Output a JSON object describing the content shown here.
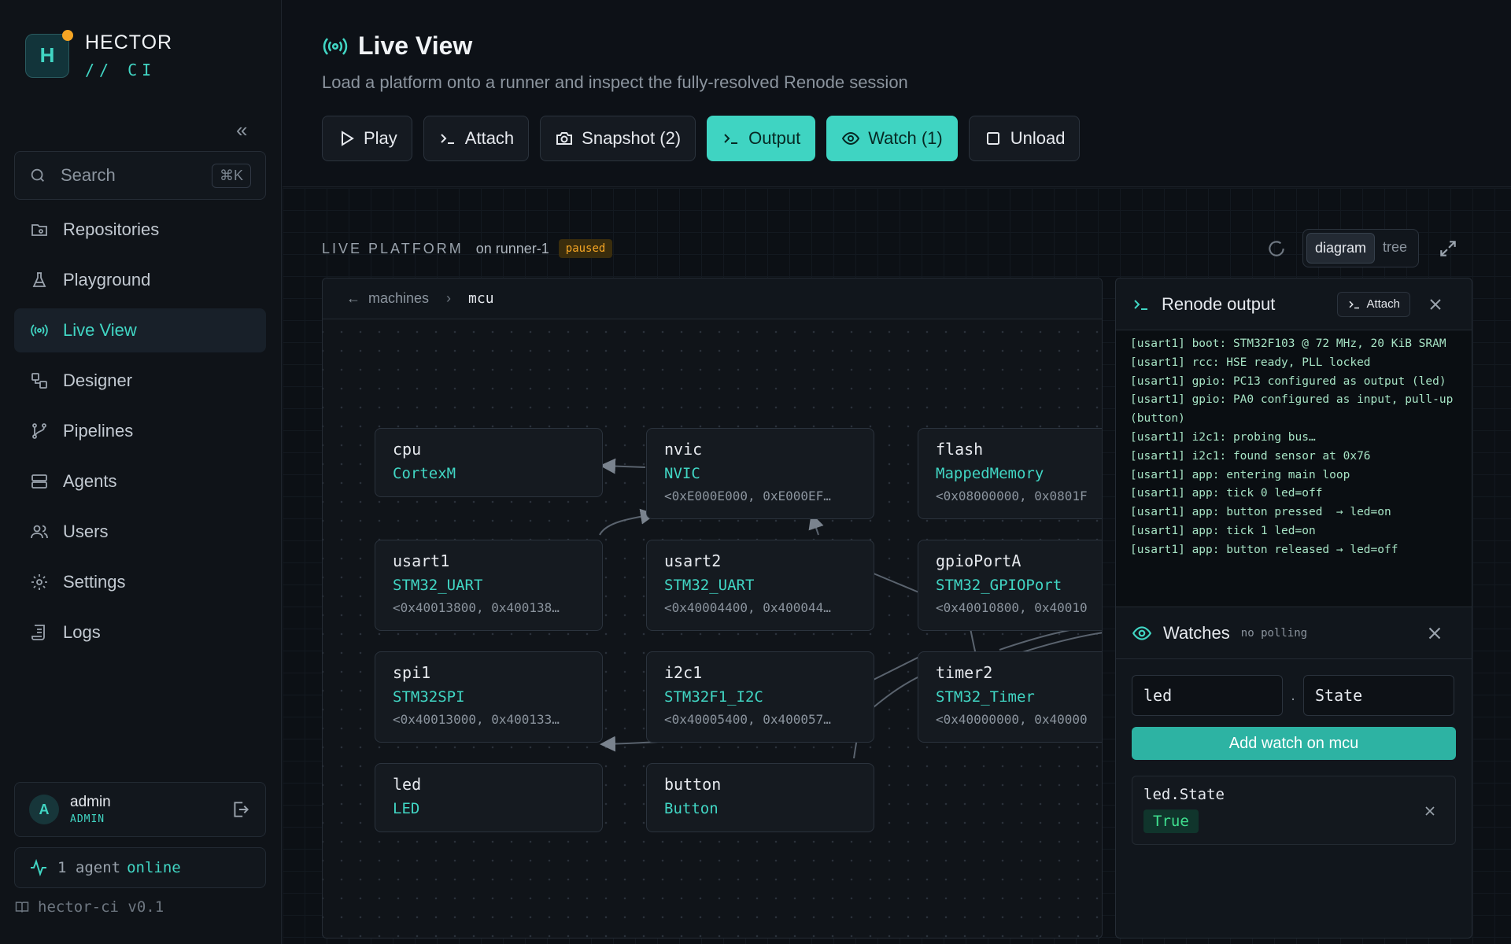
{
  "brand": {
    "logo_letter": "H",
    "name": "HECTOR",
    "sub": "// CI"
  },
  "search": {
    "placeholder": "Search",
    "shortcut": "⌘K"
  },
  "nav": [
    {
      "label": "Repositories",
      "icon": "repository-icon"
    },
    {
      "label": "Playground",
      "icon": "flask-icon"
    },
    {
      "label": "Live View",
      "icon": "broadcast-icon",
      "active": true
    },
    {
      "label": "Designer",
      "icon": "designer-icon"
    },
    {
      "label": "Pipelines",
      "icon": "pipeline-icon"
    },
    {
      "label": "Agents",
      "icon": "server-icon"
    },
    {
      "label": "Users",
      "icon": "users-icon"
    },
    {
      "label": "Settings",
      "icon": "gear-icon"
    },
    {
      "label": "Logs",
      "icon": "logs-icon"
    }
  ],
  "user": {
    "initial": "A",
    "name": "admin",
    "role": "ADMIN"
  },
  "agents": {
    "count_text": "1 agent",
    "status": "online"
  },
  "version": "hector-ci v0.1",
  "header": {
    "title": "Live View",
    "subtitle": "Load a platform onto a runner and inspect the fully-resolved Renode session"
  },
  "toolbar": {
    "play": "Play",
    "attach": "Attach",
    "snapshot": "Snapshot (2)",
    "output": "Output",
    "watch": "Watch (1)",
    "unload": "Unload"
  },
  "live": {
    "title": "LIVE PLATFORM",
    "runner": "on runner-1",
    "status": "paused",
    "view_modes": [
      "diagram",
      "tree"
    ],
    "active_view": "diagram"
  },
  "breadcrumb": {
    "parent": "machines",
    "current": "mcu"
  },
  "nodes": [
    {
      "name": "cpu",
      "type": "CortexM",
      "range": ""
    },
    {
      "name": "nvic",
      "type": "NVIC",
      "range": "<0xE000E000, 0xE000EF…"
    },
    {
      "name": "flash",
      "type": "MappedMemory",
      "range": "<0x08000000, 0x0801F"
    },
    {
      "name": "usart1",
      "type": "STM32_UART",
      "range": "<0x40013800, 0x400138…"
    },
    {
      "name": "usart2",
      "type": "STM32_UART",
      "range": "<0x40004400, 0x400044…"
    },
    {
      "name": "gpioPortA",
      "type": "STM32_GPIOPort",
      "range": "<0x40010800, 0x40010"
    },
    {
      "name": "spi1",
      "type": "STM32SPI",
      "range": "<0x40013000, 0x400133…"
    },
    {
      "name": "i2c1",
      "type": "STM32F1_I2C",
      "range": "<0x40005400, 0x400057…"
    },
    {
      "name": "timer2",
      "type": "STM32_Timer",
      "range": "<0x40000000, 0x40000"
    },
    {
      "name": "led",
      "type": "LED",
      "range": ""
    },
    {
      "name": "button",
      "type": "Button",
      "range": ""
    }
  ],
  "output": {
    "title": "Renode output",
    "attach": "Attach",
    "lines": [
      "[usart1] boot: STM32F103 @ 72 MHz, 20 KiB SRAM",
      "[usart1] rcc: HSE ready, PLL locked",
      "[usart1] gpio: PC13 configured as output (led)",
      "[usart1] gpio: PA0 configured as input, pull-up (button)",
      "[usart1] i2c1: probing bus…",
      "[usart1] i2c1: found sensor at 0x76",
      "[usart1] app: entering main loop",
      "[usart1] app: tick 0 led=off",
      "[usart1] app: button pressed  → led=on",
      "[usart1] app: tick 1 led=on",
      "[usart1] app: button released → led=off"
    ]
  },
  "watches": {
    "title": "Watches",
    "polling": "no polling",
    "peripheral_value": "led",
    "property_value": "State",
    "add_label": "Add watch on mcu",
    "items": [
      {
        "key": "led.State",
        "value": "True"
      }
    ]
  },
  "colors": {
    "accent": "#41d6c4",
    "paused": "#f5a524",
    "true_value": "#3fe08f"
  }
}
